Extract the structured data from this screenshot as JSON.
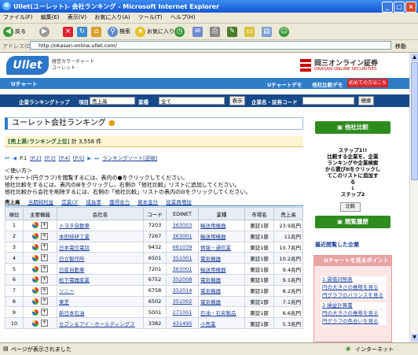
{
  "window": {
    "title": "Ullet(ユーレット)- 会社ランキング - Microsoft Internet Explorer",
    "menu": [
      "ファイル(F)",
      "編集(E)",
      "表示(V)",
      "お気に入り(A)",
      "ツール(T)",
      "ヘルプ(H)"
    ],
    "toolbar": {
      "back": "戻る",
      "search": "検索",
      "favorites": "お気に入り"
    },
    "address_label": "アドレス(D)",
    "address": "http://okasan-online.ullet.com/",
    "go": "移動",
    "status": "ページが表示されました",
    "zone": "インターネット"
  },
  "site": {
    "logo": "Ullet",
    "logo_sub1": "経営カラーチャート",
    "logo_sub2": "ユーレット",
    "brand": "岡三オンライン証券",
    "brand_en": "OKASAN ONLINE SECURITIES",
    "nav_tab": "Uチャート",
    "nav_links": "Uチャートデモ　　他社比較デモ",
    "login": "初めての方はこちら"
  },
  "search": {
    "ranking_top": "企業ランキングトップ",
    "item_label": "項目",
    "item_value": "売上高",
    "industry_label": "業種",
    "industry_value": "全て",
    "show_btn": "表示",
    "code_label": "企業名・証券コード",
    "search_btn": "検索"
  },
  "main": {
    "heading": "ユーレット会社ランキング",
    "subhead": "[売上高:ランキング上位",
    "subhead_count": "] 計 3,558 件",
    "pager_current": "P.1",
    "pager_pages": [
      "[P.2]",
      "[P.3]",
      "[P.4]",
      "[P.5]"
    ],
    "pager_sort": "ランキングソート[逆順]",
    "howto_title": "＜使い方＞",
    "howto_lines": [
      "Uチャート(円グラフ)を閲覧するには、表内の●をクリックしてください。",
      "他社比較をするには、表内の⊞をクリックし、右側の「他社比較」リストに追加してください。",
      "他社比較から会社を削除するには、右側の「他社比較」リストの表内の⊟をクリックしてください。"
    ],
    "sort_items": [
      "売上高",
      "当期純利益",
      "営業CF",
      "成長率",
      "獲得余力",
      "資本金計",
      "従業員増加"
    ],
    "table_headers": [
      "順位",
      "主要機能",
      "会社名",
      "コード",
      "EDINET",
      "業種",
      "市場名",
      "売上高"
    ],
    "rows": [
      {
        "rank": "1",
        "name": "トヨタ自動車",
        "code": "7203",
        "edinet": "363003",
        "industry": "輸送用機器",
        "market": "東証1部",
        "sales": "23.9兆円"
      },
      {
        "rank": "2",
        "name": "本田技研工業",
        "code": "7267",
        "edinet": "363001",
        "industry": "輸送用機器",
        "market": "東証1部",
        "sales": "11兆円"
      },
      {
        "rank": "3",
        "name": "日本電信電話",
        "code": "9432",
        "edinet": "681039",
        "industry": "情報・通信業",
        "market": "東証1部",
        "sales": "10.7兆円"
      },
      {
        "rank": "4",
        "name": "日立製作所",
        "code": "6501",
        "edinet": "351001",
        "industry": "電気機器",
        "market": "東証1部",
        "sales": "10.2兆円"
      },
      {
        "rank": "5",
        "name": "日産自動車",
        "code": "7201",
        "edinet": "363001",
        "industry": "輸送用機器",
        "market": "東証1部",
        "sales": "9.4兆円"
      },
      {
        "rank": "6",
        "name": "松下電器産業",
        "code": "6752",
        "edinet": "352008",
        "industry": "電気機器",
        "market": "東証1部",
        "sales": "9.1兆円"
      },
      {
        "rank": "7",
        "name": "ソニー",
        "code": "6758",
        "edinet": "352014",
        "industry": "電気機器",
        "market": "東証1部",
        "sales": "8.2兆円"
      },
      {
        "rank": "8",
        "name": "東芝",
        "code": "6502",
        "edinet": "351002",
        "industry": "電気機器",
        "market": "東証1部",
        "sales": "7.1兆円"
      },
      {
        "rank": "9",
        "name": "新日本石油",
        "code": "5001",
        "edinet": "271001",
        "industry": "石油・石炭製品",
        "market": "東証1部",
        "sales": "6.6兆円"
      },
      {
        "rank": "10",
        "name": "セブン＆アイ・ホールディングス",
        "code": "3382",
        "edinet": "431495",
        "industry": "小売業",
        "market": "東証1部",
        "sales": "5.3兆円"
      }
    ]
  },
  "side": {
    "compare_btn": "他社比較",
    "step_text": [
      "ステップ1!!",
      "比較する企業を、企業",
      "ランキングや企業検索",
      "から選び⊞をクリックし",
      "てこのリストに追加す",
      "る",
      "↓",
      "ステップ2"
    ],
    "compare_small": "比較",
    "history_btn": "閲覧履歴",
    "recent": "最近閲覧した企業",
    "point_title": "Uチャートを見るポイント",
    "point_lines": [
      "1.貸借対照表",
      "円の大きさの推移を見る",
      "円グラフのバランスを見る",
      "2.損益計算書",
      "円の大きさの推移を見る",
      "円グラフの色合いを見る"
    ]
  }
}
